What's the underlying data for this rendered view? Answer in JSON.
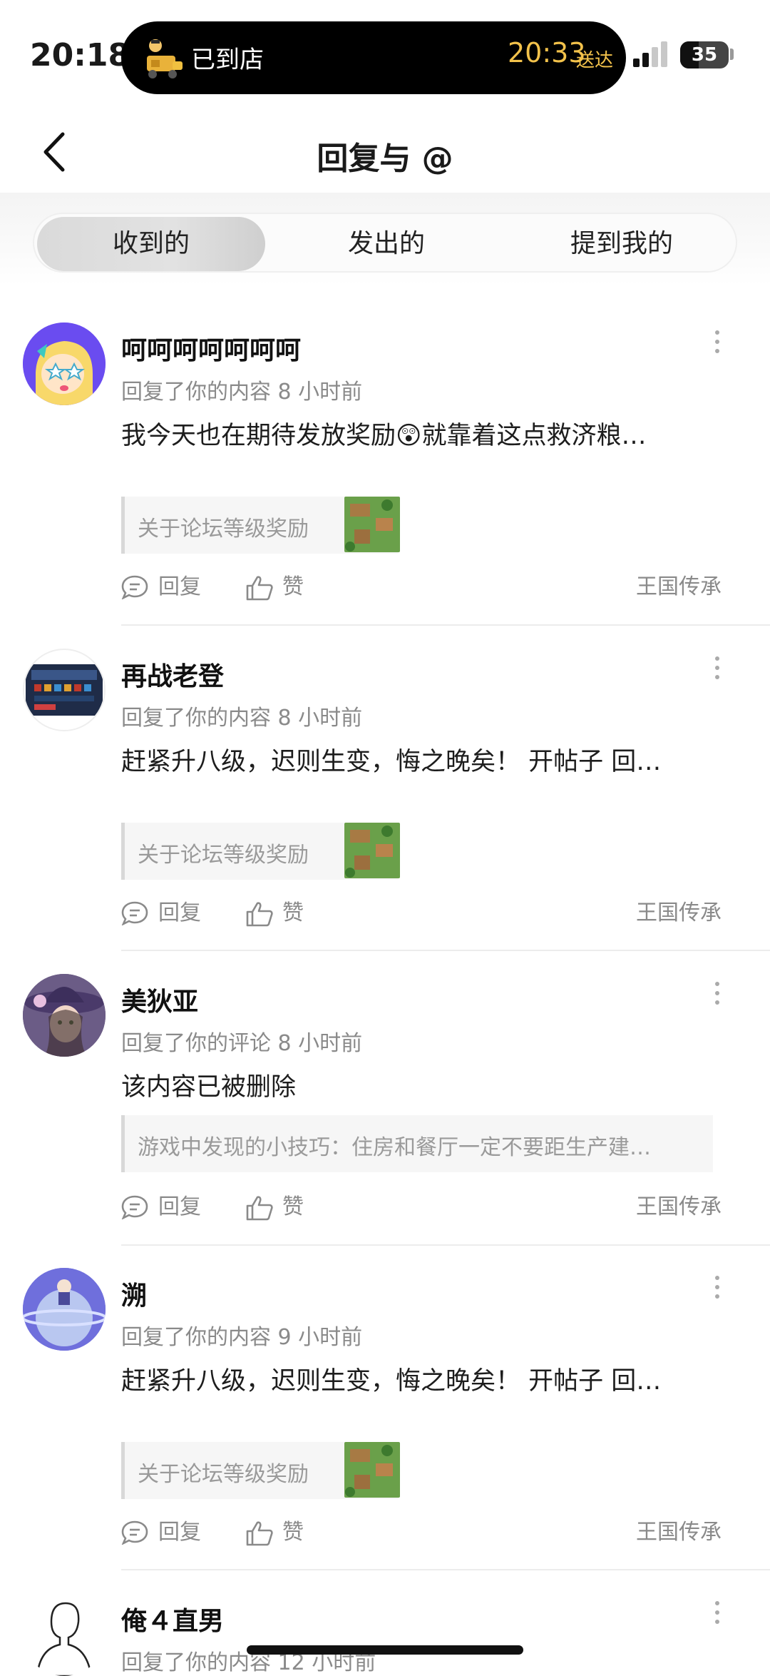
{
  "status_bar": {
    "time": "20:18",
    "island_label": "已到店",
    "island_time": "20:33",
    "island_sub": "送达",
    "battery": "35",
    "island_icon": "delivery-icon",
    "signal_icon": "signal-icon"
  },
  "header": {
    "title": "回复与 @",
    "back_icon": "chevron-left-icon"
  },
  "tabs": [
    {
      "label": "收到的",
      "active": true
    },
    {
      "label": "发出的",
      "active": false
    },
    {
      "label": "提到我的",
      "active": false
    }
  ],
  "items": [
    {
      "name": "呵呵呵呵呵呵呵",
      "meta": "回复了你的内容 8 小时前",
      "content": "我今天也在期待发放奖励😲就靠着这点救济粮…",
      "quote": "关于论坛等级奖励",
      "reply_label": "回复",
      "like_label": "赞",
      "game": "王国传承"
    },
    {
      "name": "再战老登",
      "meta": "回复了你的内容 8 小时前",
      "content": "赶紧升八级，迟则生变，悔之晚矣！ 开帖子 回…",
      "quote": "关于论坛等级奖励",
      "reply_label": "回复",
      "like_label": "赞",
      "game": "王国传承"
    },
    {
      "name": "美狄亚",
      "meta": "回复了你的评论 8 小时前",
      "content": "该内容已被删除",
      "quote": "游戏中发现的小技巧：住房和餐厅一定不要距生产建…",
      "reply_label": "回复",
      "like_label": "赞",
      "game": "王国传承"
    },
    {
      "name": "溯",
      "meta": "回复了你的内容 9 小时前",
      "content": "赶紧升八级，迟则生变，悔之晚矣！ 开帖子 回…",
      "quote": "关于论坛等级奖励",
      "reply_label": "回复",
      "like_label": "赞",
      "game": "王国传承"
    },
    {
      "name": "俺４直男",
      "meta": "回复了你的内容 12 小时前"
    }
  ]
}
